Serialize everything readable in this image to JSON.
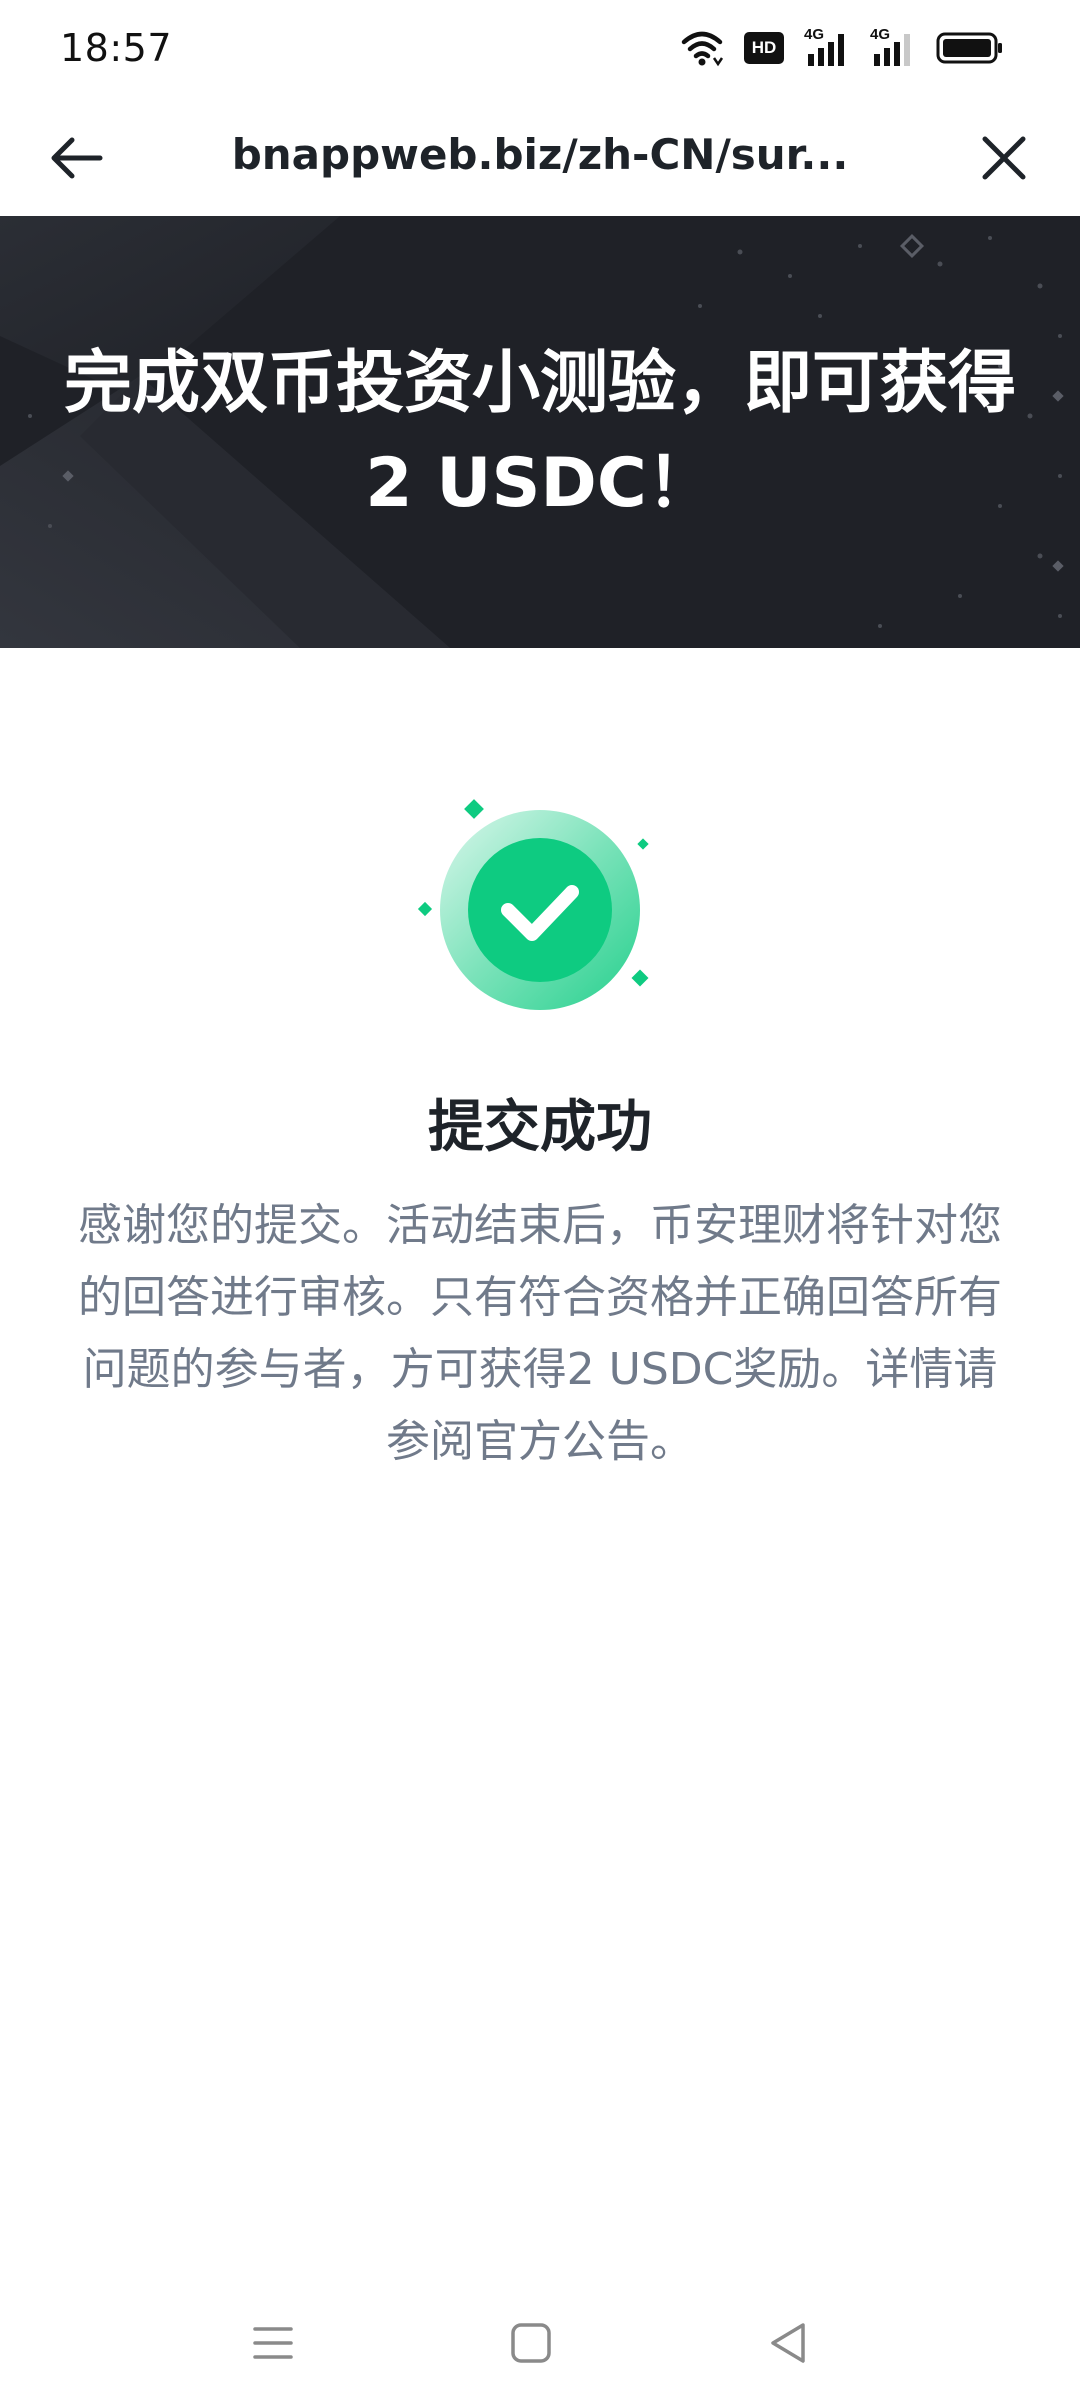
{
  "status_bar": {
    "time": "18:57",
    "icons": [
      "wifi-icon",
      "hd-voice-icon",
      "signal-4g-icon",
      "signal-4g-icon",
      "battery-icon"
    ],
    "hd_label": "HD",
    "network_label": "4G"
  },
  "app_bar": {
    "url": "bnappweb.biz/zh-CN/sur...",
    "back_icon": "arrow-left-icon",
    "close_icon": "close-icon"
  },
  "hero": {
    "title": "完成双币投资小测验，即可获得 2 USDC！"
  },
  "success": {
    "icon": "check-circle-icon",
    "accent_color": "#0ecb81",
    "title": "提交成功",
    "message": "感谢您的提交。活动结束后，币安理财将针对您的回答进行审核。只有符合资格并正确回答所有问题的参与者，方可获得2 USDC奖励。详情请参阅官方公告。"
  },
  "nav_bar": {
    "icons": [
      "menu-icon",
      "home-icon",
      "back-icon"
    ]
  }
}
